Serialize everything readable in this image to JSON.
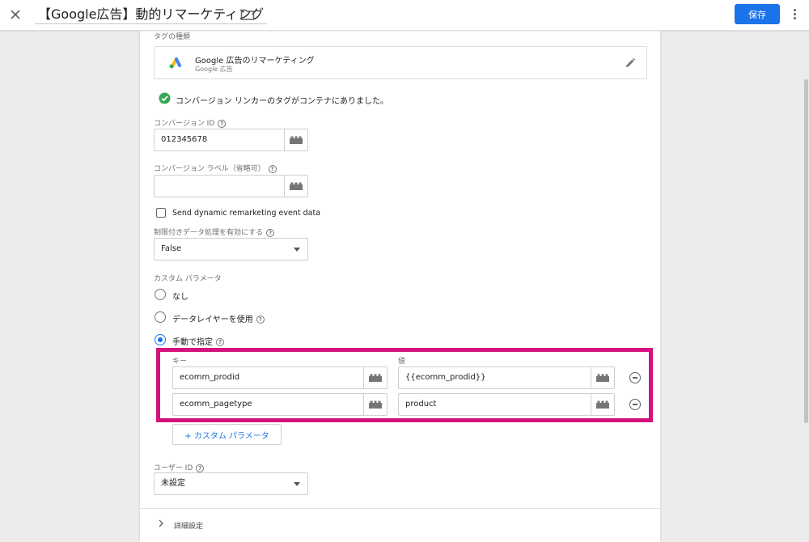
{
  "header": {
    "title": "【Google広告】動的リマーケティング",
    "save_label": "保存"
  },
  "tag_type": {
    "label": "タグの種類",
    "name": "Google 広告のリマーケティング",
    "vendor": "Google 広告"
  },
  "linker_notice": "コンバージョン リンカーのタグがコンテナにありました。",
  "conversion_id": {
    "label": "コンバージョン ID",
    "value": "012345678"
  },
  "conversion_label": {
    "label": "コンバージョン ラベル（省略可）",
    "value": ""
  },
  "dynamic_checkbox": {
    "label": "Send dynamic remarketing event data",
    "checked": false
  },
  "restricted_data": {
    "label": "制限付きデータ処理を有効にする",
    "value": "False"
  },
  "custom_params": {
    "label": "カスタム パラメータ",
    "options": [
      {
        "label": "なし",
        "selected": false
      },
      {
        "label": "データレイヤーを使用",
        "selected": false
      },
      {
        "label": "手動で指定",
        "selected": true
      }
    ],
    "key_header": "キー",
    "value_header": "値",
    "rows": [
      {
        "key": "ecomm_prodid",
        "value": "{{ecomm_prodid}}"
      },
      {
        "key": "ecomm_pagetype",
        "value": "product"
      }
    ],
    "add_label": "+ カスタム パラメータ"
  },
  "user_id": {
    "label": "ユーザー ID",
    "value": "未設定"
  },
  "advanced": {
    "label": "詳細設定"
  },
  "colors": {
    "primary": "#1a73e8",
    "highlight": "#d4127e",
    "success": "#34a853"
  }
}
